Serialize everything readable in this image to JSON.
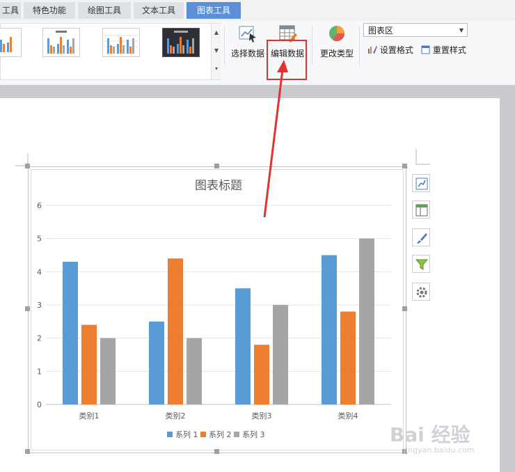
{
  "tabs": [
    {
      "label": "工具",
      "state": "inactive"
    },
    {
      "label": "特色功能",
      "state": "inactive"
    },
    {
      "label": "绘图工具",
      "state": "inactive"
    },
    {
      "label": "文本工具",
      "state": "inactive"
    },
    {
      "label": "图表工具",
      "state": "active"
    }
  ],
  "ribbon": {
    "select_data": "选择数据",
    "edit_data": "编辑数据",
    "change_type": "更改类型",
    "element_select": "图表区",
    "set_format": "设置格式",
    "reset_style": "重置样式"
  },
  "colors": {
    "series1": "#5b9bd5",
    "series2": "#ed7d31",
    "series3": "#a5a5a5",
    "highlight": "#e5312e",
    "active_tab": "#5b8fd9"
  },
  "chart_data": {
    "type": "bar",
    "title": "图表标题",
    "categories": [
      "类别1",
      "类别2",
      "类别3",
      "类别4"
    ],
    "series": [
      {
        "name": "系列 1",
        "values": [
          4.3,
          2.5,
          3.5,
          4.5
        ]
      },
      {
        "name": "系列 2",
        "values": [
          2.4,
          4.4,
          1.8,
          2.8
        ]
      },
      {
        "name": "系列 3",
        "values": [
          2,
          2,
          3,
          5
        ]
      }
    ],
    "yticks": [
      "0",
      "1",
      "2",
      "3",
      "4",
      "5",
      "6"
    ],
    "ylim": [
      0,
      6
    ],
    "grid": true,
    "legend": "bottom"
  },
  "side_buttons": [
    "chart-elements-icon",
    "layout-icon",
    "brush-icon",
    "filter-icon",
    "settings-icon"
  ],
  "watermark": {
    "main": "Bai 经验",
    "sub": "jingyan.baidu.com"
  }
}
